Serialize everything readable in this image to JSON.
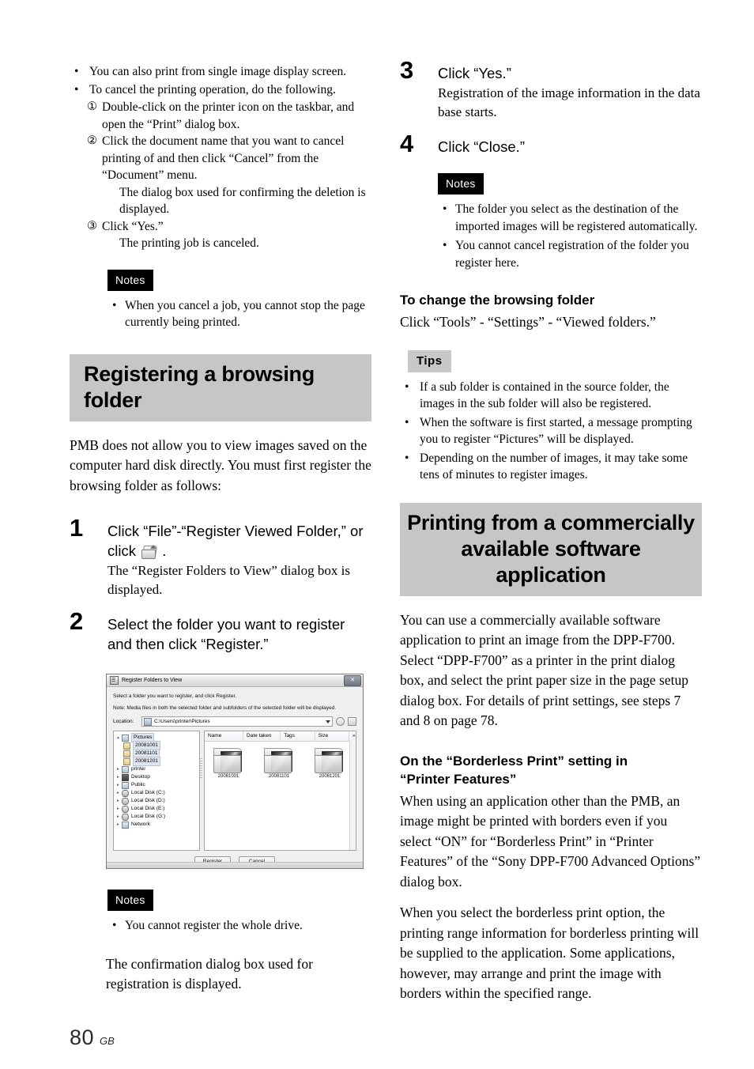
{
  "page": {
    "number": "80",
    "region_code": "GB"
  },
  "left_column": {
    "top_bullets": [
      "You can also print from single image display screen.",
      "To cancel the printing operation, do the following."
    ],
    "circled_steps": [
      {
        "marker": "①",
        "text": "Double-click on the printer icon on the taskbar, and open the “Print” dialog box."
      },
      {
        "marker": "②",
        "text": "Click the document name that you want to cancel printing of and then click “Cancel” from the “Document” menu.",
        "note": "The dialog box used for confirming the deletion is displayed."
      },
      {
        "marker": "③",
        "text": "Click “Yes.”",
        "note": "The printing job is canceled."
      }
    ],
    "notes_1": {
      "label": "Notes",
      "items": [
        "When you cancel a job, you cannot stop the page currently being printed."
      ]
    },
    "section_heading": "Registering a browsing folder",
    "intro_paragraph": "PMB does not allow you to view images saved on the computer hard disk directly. You must first register the browsing folder as follows:",
    "steps": [
      {
        "number": "1",
        "title_before_icon": "Click “File”-“Register Viewed Folder,” or click",
        "title_after_icon": ".",
        "icon_name": "register-viewed-folder-icon",
        "description": "The “Register Folders to View” dialog box is displayed."
      },
      {
        "number": "2",
        "title": "Select the folder you want to register and then click “Register.”"
      }
    ],
    "notes_2": {
      "label": "Notes",
      "items": [
        "You cannot register the whole drive."
      ]
    },
    "closing_paragraph": "The confirmation dialog box used for registration is displayed."
  },
  "dialog": {
    "title": "Register Folders to View",
    "close_label": "✕",
    "instruction_1": "Select a folder you want to register, and click Register.",
    "instruction_2": "Note: Media files in both the selected folder and subfolders of the selected folder will be displayed.",
    "location_label": "Location:",
    "location_value": "C:\\Users\\printer\\Pictures",
    "tree": [
      {
        "label": "Pictures",
        "indent": 0,
        "icon": "pictures-icon",
        "expander": "▴",
        "selected": true
      },
      {
        "label": "20081001",
        "indent": 1,
        "icon": "folder-icon",
        "expander": "",
        "selected": true
      },
      {
        "label": "20081101",
        "indent": 1,
        "icon": "folder-icon",
        "expander": "",
        "selected": true
      },
      {
        "label": "20081201",
        "indent": 1,
        "icon": "folder-icon",
        "expander": "",
        "selected": true
      },
      {
        "label": "printer",
        "indent": 0,
        "icon": "user-icon",
        "expander": "▸",
        "selected": false
      },
      {
        "label": "Desktop",
        "indent": 0,
        "icon": "desktop-icon",
        "expander": "▸",
        "selected": false
      },
      {
        "label": "Public",
        "indent": 0,
        "icon": "public-icon",
        "expander": "▸",
        "selected": false
      },
      {
        "label": "Local Disk (C:)",
        "indent": 0,
        "icon": "harddisk-icon",
        "expander": "▸",
        "selected": false
      },
      {
        "label": "Local Disk (D:)",
        "indent": 0,
        "icon": "drive-icon",
        "expander": "▸",
        "selected": false
      },
      {
        "label": "Local Disk (E:)",
        "indent": 0,
        "icon": "drive-icon",
        "expander": "▸",
        "selected": false
      },
      {
        "label": "Local Disk (G:)",
        "indent": 0,
        "icon": "drive-icon",
        "expander": "▸",
        "selected": false
      },
      {
        "label": "Network",
        "indent": 0,
        "icon": "network-icon",
        "expander": "▸",
        "selected": false
      }
    ],
    "columns": [
      "Name",
      "Date taken",
      "Tags",
      "Size"
    ],
    "column_overflow": "»",
    "thumbnails": [
      {
        "caption": "20081001"
      },
      {
        "caption": "20081101"
      },
      {
        "caption": "20081201"
      }
    ],
    "buttons": {
      "register": "Register",
      "cancel": "Cancel"
    }
  },
  "right_column": {
    "steps": [
      {
        "number": "3",
        "title": "Click “Yes.”",
        "description": "Registration of the image information in the data base starts."
      },
      {
        "number": "4",
        "title": "Click “Close.”"
      }
    ],
    "notes": {
      "label": "Notes",
      "items": [
        "The folder you select as the destination of the imported images will be registered automatically.",
        "You cannot cancel registration of the folder you register here."
      ]
    },
    "change_folder": {
      "heading": "To change the browsing folder",
      "text": "Click “Tools” - “Settings” - “Viewed folders.”"
    },
    "tips": {
      "label": "Tips",
      "items": [
        "If a sub folder is contained in the source folder, the images in the sub folder will also be registered.",
        "When the software is first started, a message prompting you to register “Pictures” will be displayed.",
        "Depending on the number of images, it may take some tens of minutes to register images."
      ]
    },
    "section_heading_line1": "Printing from a commercially",
    "section_heading_line2": "available software application",
    "intro_paragraph": "You can use a commercially available software application to print an image from the DPP-F700. Select “DPP-F700” as a printer in the print dialog box, and select the print paper size in the page setup dialog box. For details of print settings, see steps 7 and 8 on page 78.",
    "borderless": {
      "heading_line1": "On the “Borderless Print” setting in",
      "heading_line2": "“Printer Features”",
      "paragraph_1": "When using an application other than the PMB, an image might be printed with borders even if you select “ON” for  “Borderless Print” in “Printer Features” of the “Sony DPP-F700 Advanced Options” dialog box.",
      "paragraph_2": "When you select the borderless print option, the printing range information for borderless printing will be supplied to the application. Some applications, however, may arrange and print the image with borders within the specified range."
    }
  },
  "colors": {
    "heading_band": "#c6c6c6",
    "notes_badge_bg": "#000000",
    "tips_badge_bg": "#c8c8c8"
  }
}
